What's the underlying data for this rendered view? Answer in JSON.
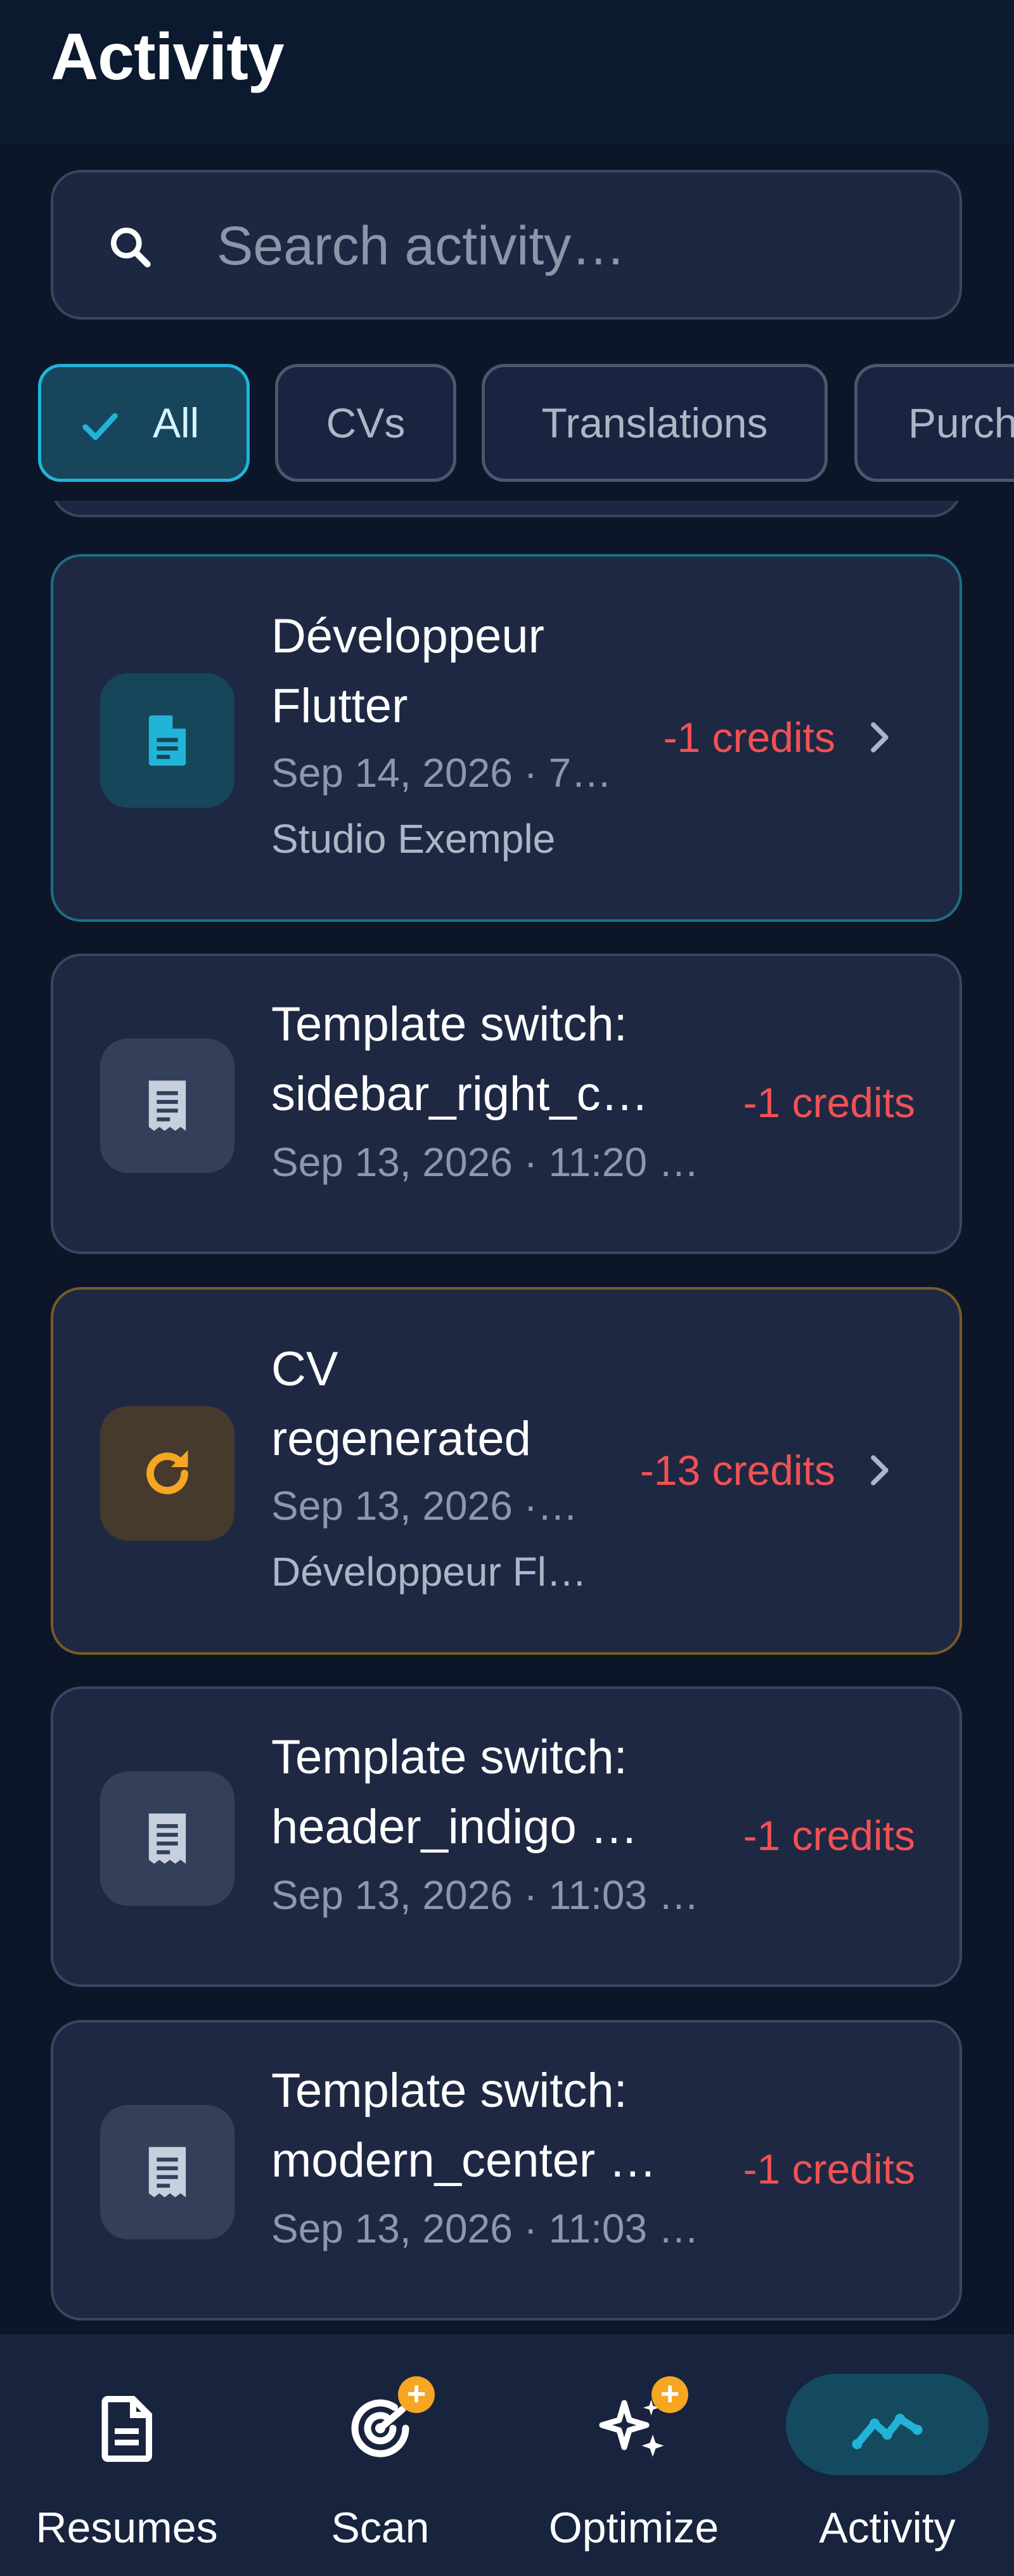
{
  "header": {
    "title": "Activity"
  },
  "search": {
    "placeholder": "Search activity…"
  },
  "filters": [
    {
      "label": "All",
      "selected": true
    },
    {
      "label": "CVs",
      "selected": false
    },
    {
      "label": "Translations",
      "selected": false
    },
    {
      "label": "Purch",
      "selected": false
    }
  ],
  "activities": [
    {
      "title_lines": [
        "Développeur",
        "Flutter"
      ],
      "date": "Sep 14, 2026 · 7:…",
      "subtitle": "Studio Exemple",
      "credits": "-1 credits",
      "icon": "document-icon",
      "has_chevron": true
    },
    {
      "title_lines": [
        "Template switch:",
        "sidebar_right_c…"
      ],
      "date": "Sep 13, 2026 · 11:20 …",
      "credits": "-1 credits",
      "icon": "receipt-icon",
      "has_chevron": false
    },
    {
      "title_lines": [
        "CV",
        "regenerated"
      ],
      "date": "Sep 13, 2026 · 1…",
      "subtitle": "Développeur Fl…",
      "credits": "-13 credits",
      "icon": "refresh-icon",
      "has_chevron": true
    },
    {
      "title_lines": [
        "Template switch:",
        "header_indigo …"
      ],
      "date": "Sep 13, 2026 · 11:03 …",
      "credits": "-1 credits",
      "icon": "receipt-icon",
      "has_chevron": false
    },
    {
      "title_lines": [
        "Template switch:",
        "modern_center …"
      ],
      "date": "Sep 13, 2026 · 11:03 …",
      "credits": "-1 credits",
      "icon": "receipt-icon",
      "has_chevron": false
    }
  ],
  "nav": [
    {
      "label": "Resumes",
      "icon": "document-icon",
      "badge": null,
      "active": false
    },
    {
      "label": "Scan",
      "icon": "target-scan-icon",
      "badge": "+",
      "active": false
    },
    {
      "label": "Optimize",
      "icon": "sparkles-icon",
      "badge": "+",
      "active": false
    },
    {
      "label": "Activity",
      "icon": "trend-line-icon",
      "badge": null,
      "active": true
    }
  ],
  "colors": {
    "accent": "#22b4d8",
    "credits_negative": "#f25153",
    "warning": "#f5a623",
    "background": "#0d1629",
    "card": "#1f2843"
  }
}
